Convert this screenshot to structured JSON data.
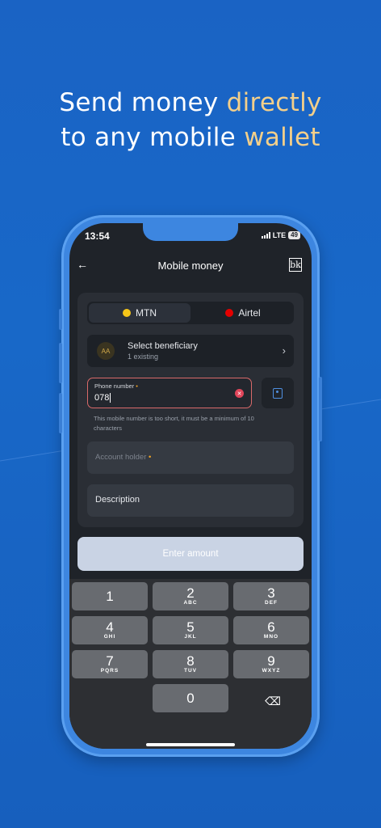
{
  "headline": {
    "line1_plain": "Send money ",
    "line1_accent": "directly",
    "line2_plain": "to any mobile ",
    "line2_accent": "wallet"
  },
  "status": {
    "time": "13:54",
    "network": "LTE",
    "battery": "49"
  },
  "nav": {
    "back": "←",
    "title": "Mobile money",
    "logo": "bk"
  },
  "providers": [
    {
      "label": "MTN",
      "selected": true,
      "logo_text": "MTN"
    },
    {
      "label": "Airtel",
      "selected": false,
      "logo_text": "airtel"
    }
  ],
  "beneficiary": {
    "initials": "AA",
    "title": "Select beneficiary",
    "subtitle": "1 existing",
    "chevron": "›"
  },
  "phone_field": {
    "label": "Phone number",
    "required_mark": "•",
    "value": "078",
    "error": "This mobile number is too short, it must be a minimum of 10 characters"
  },
  "account_holder": {
    "placeholder": "Account holder",
    "required_mark": "•"
  },
  "description": {
    "placeholder": "Description"
  },
  "enter_button": "Enter amount",
  "keypad": [
    {
      "num": "1",
      "letters": ""
    },
    {
      "num": "2",
      "letters": "ABC"
    },
    {
      "num": "3",
      "letters": "DEF"
    },
    {
      "num": "4",
      "letters": "GHI"
    },
    {
      "num": "5",
      "letters": "JKL"
    },
    {
      "num": "6",
      "letters": "MNO"
    },
    {
      "num": "7",
      "letters": "PQRS"
    },
    {
      "num": "8",
      "letters": "TUV"
    },
    {
      "num": "9",
      "letters": "WXYZ"
    },
    {
      "num": "0",
      "letters": ""
    }
  ],
  "backspace": "⌫",
  "colors": {
    "background": "#1a63c4",
    "accent_text": "#f3cf8a",
    "phone_frame": "#3d86e0",
    "screen": "#1f2329",
    "error_border": "#d96a6a",
    "required_dot": "#f5a623"
  }
}
